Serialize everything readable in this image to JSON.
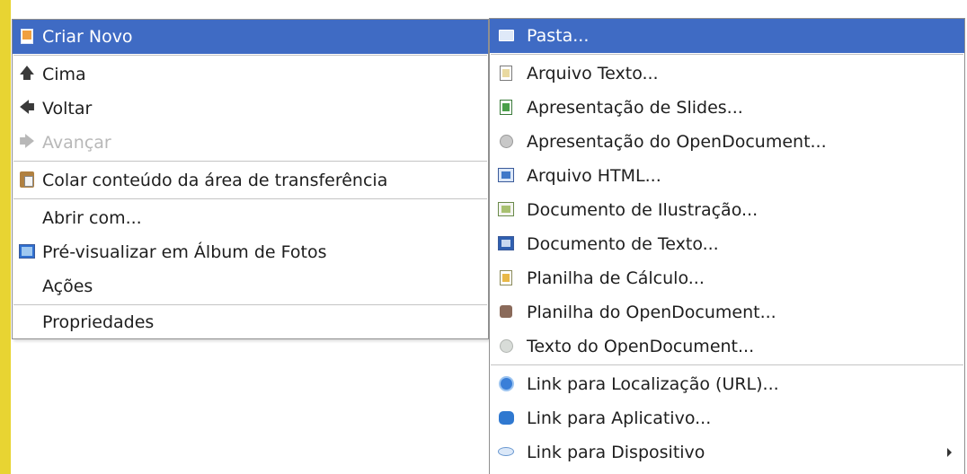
{
  "main_menu": {
    "items": [
      {
        "label": "Criar Novo",
        "icon": "new-document-icon",
        "highlighted": true
      },
      {
        "label": "Cima",
        "icon": "up-arrow-icon"
      },
      {
        "label": "Voltar",
        "icon": "back-arrow-icon"
      },
      {
        "label": "Avançar",
        "icon": "forward-arrow-icon",
        "disabled": true
      },
      {
        "label": "Colar conteúdo da área de transferência",
        "icon": "paste-icon"
      },
      {
        "label": "Abrir com...",
        "icon": ""
      },
      {
        "label": "Pré-visualizar em Álbum de Fotos",
        "icon": "photo-album-icon"
      },
      {
        "label": "Ações",
        "icon": ""
      },
      {
        "label": "Propriedades",
        "icon": ""
      }
    ]
  },
  "sub_menu": {
    "items": [
      {
        "label": "Pasta...",
        "icon": "folder-icon",
        "highlighted": true
      },
      {
        "label": "Arquivo Texto...",
        "icon": "text-file-icon"
      },
      {
        "label": "Apresentação de Slides...",
        "icon": "presentation-icon"
      },
      {
        "label": "Apresentação do OpenDocument...",
        "icon": "opendocument-presentation-icon"
      },
      {
        "label": "Arquivo HTML...",
        "icon": "html-file-icon"
      },
      {
        "label": "Documento de Ilustração...",
        "icon": "drawing-document-icon"
      },
      {
        "label": "Documento de Texto...",
        "icon": "text-document-icon"
      },
      {
        "label": "Planilha de Cálculo...",
        "icon": "spreadsheet-icon"
      },
      {
        "label": "Planilha do OpenDocument...",
        "icon": "opendocument-spreadsheet-icon"
      },
      {
        "label": "Texto do OpenDocument...",
        "icon": "opendocument-text-icon"
      },
      {
        "label": "Link para Localização (URL)...",
        "icon": "globe-link-icon"
      },
      {
        "label": "Link para Aplicativo...",
        "icon": "application-link-icon"
      },
      {
        "label": "Link para Dispositivo",
        "icon": "device-link-icon",
        "has_submenu": true
      }
    ]
  },
  "colors": {
    "highlight": "#3f6bc4",
    "highlight_text": "#ffffff",
    "menu_border": "#8f8f8f",
    "separator": "#c4c4c4",
    "disabled_text": "#b8b8b8",
    "left_strip": "#e8d432"
  }
}
